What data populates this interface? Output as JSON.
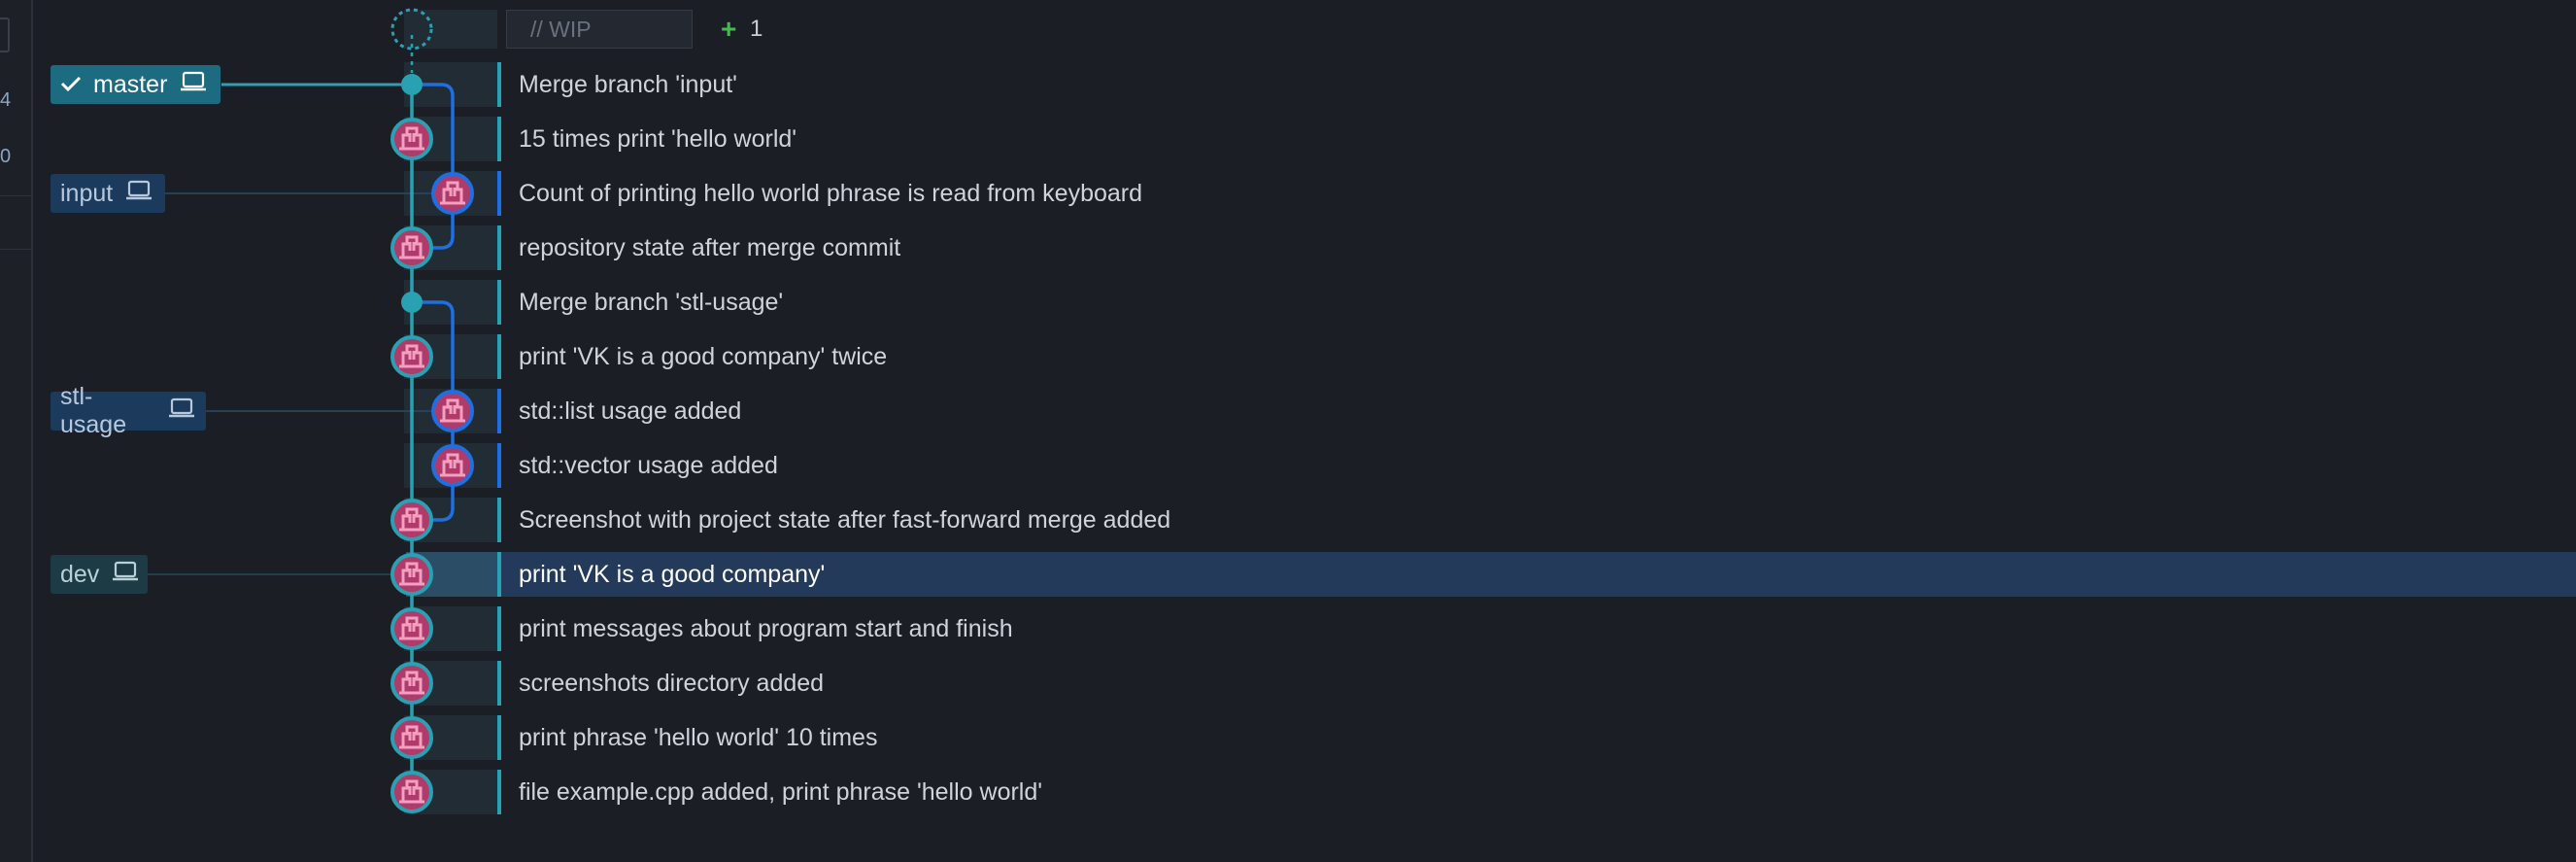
{
  "wip": {
    "placeholder": "// WIP",
    "change_count": "1",
    "plus_symbol": "+"
  },
  "branches": [
    {
      "name": "master",
      "style": "master",
      "checked": true
    },
    {
      "name": "input",
      "style": "other",
      "checked": false
    },
    {
      "name": "stl-usage",
      "style": "other",
      "checked": false
    },
    {
      "name": "dev",
      "style": "dev",
      "checked": false
    }
  ],
  "commits": [
    {
      "message": "Merge branch 'input'",
      "lane": 0,
      "merge": true
    },
    {
      "message": "15 times print 'hello world'",
      "lane": 0
    },
    {
      "message": "Count of printing hello world phrase is read from keyboard",
      "lane": 1
    },
    {
      "message": "repository state after merge commit",
      "lane": 0
    },
    {
      "message": "Merge branch 'stl-usage'",
      "lane": 0,
      "merge": true
    },
    {
      "message": "print 'VK is a good company' twice",
      "lane": 0
    },
    {
      "message": "std::list usage added",
      "lane": 1
    },
    {
      "message": "std::vector usage added",
      "lane": 1
    },
    {
      "message": "Screenshot with project state after fast-forward merge added",
      "lane": 0
    },
    {
      "message": "print 'VK is a good company'",
      "lane": 0,
      "selected": true
    },
    {
      "message": "print messages about program start and finish",
      "lane": 0
    },
    {
      "message": "screenshots directory added",
      "lane": 0
    },
    {
      "message": "print phrase 'hello world' 10 times",
      "lane": 0
    },
    {
      "message": "file example.cpp added, print phrase 'hello world'",
      "lane": 0
    }
  ],
  "left_strip_marks": [
    "4",
    "0"
  ],
  "colors": {
    "lane_main": "#2aa1b3",
    "lane_branch": "#1f6fe0",
    "selected_row": "#243a5a",
    "avatar_fill": "#b03a6a",
    "avatar_glyph": "#f2a0c0"
  },
  "icons": {
    "branch_local": "laptop-icon",
    "checked_out": "check-icon",
    "author": "avatar-icon"
  }
}
